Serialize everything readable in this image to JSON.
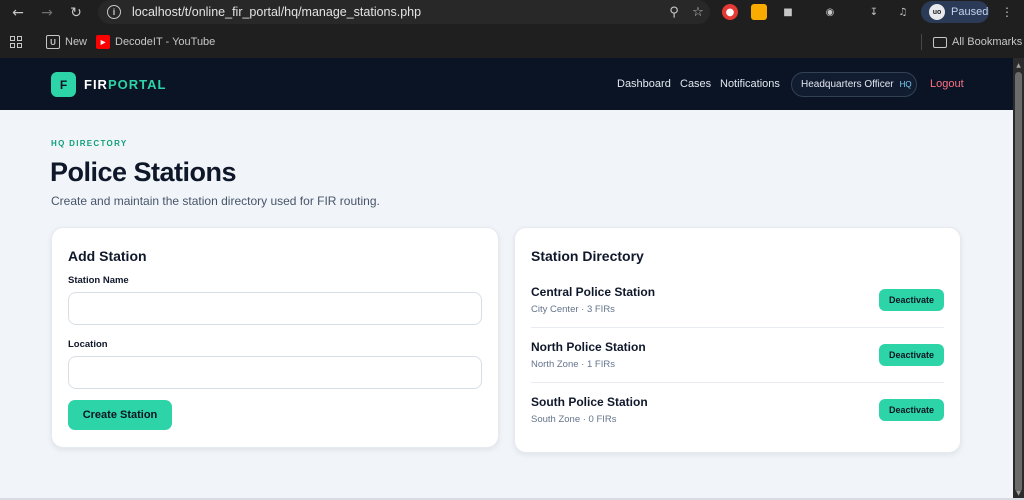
{
  "browser": {
    "url": "localhost/t/online_fir_portal/hq/manage_stations.php",
    "profile_label": "Paused",
    "profile_initials": "uo",
    "bookmarks": [
      {
        "label": "New"
      },
      {
        "label": "DecodeIT - YouTube"
      }
    ],
    "all_bookmarks": "All Bookmarks"
  },
  "app": {
    "logo_letter": "F",
    "logo_part1": "FIR",
    "logo_part2": "PORTAL",
    "nav": [
      "Dashboard",
      "Cases",
      "Notifications"
    ],
    "user_name": "Headquarters Officer",
    "user_role": "HQ",
    "logout": "Logout"
  },
  "page": {
    "eyebrow": "HQ DIRECTORY",
    "title": "Police Stations",
    "subtitle": "Create and maintain the station directory used for FIR routing."
  },
  "add_station": {
    "title": "Add Station",
    "name_label": "Station Name",
    "name_value": "",
    "location_label": "Location",
    "location_value": "",
    "submit_label": "Create Station"
  },
  "directory": {
    "title": "Station Directory",
    "stations": [
      {
        "name": "Central Police Station",
        "meta": "City Center · 3 FIRs",
        "action": "Deactivate"
      },
      {
        "name": "North Police Station",
        "meta": "North Zone · 1 FIRs",
        "action": "Deactivate"
      },
      {
        "name": "South Police Station",
        "meta": "South Zone · 0 FIRs",
        "action": "Deactivate"
      }
    ]
  },
  "colors": {
    "accent": "#2dd4a7",
    "header_bg": "#0b1424",
    "page_bg": "#f1f5f9",
    "logout": "#fb7185"
  }
}
